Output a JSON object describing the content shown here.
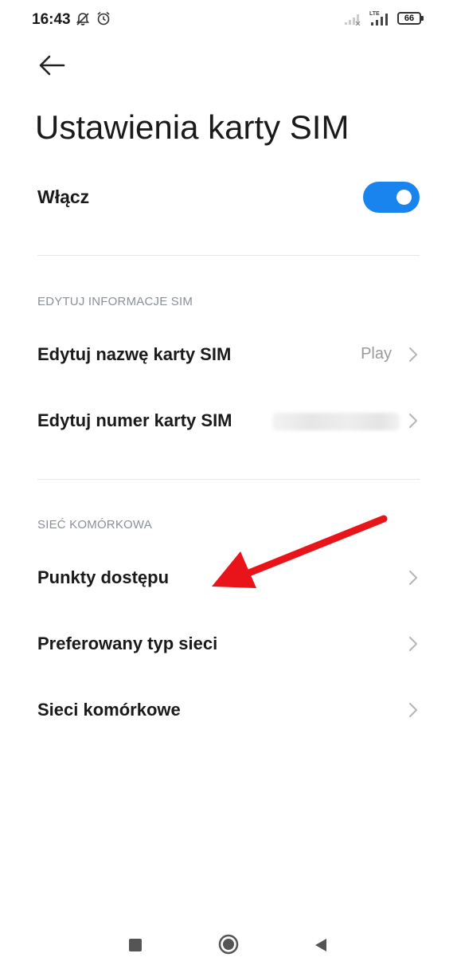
{
  "status_bar": {
    "time": "16:43",
    "icons": [
      "notifications-off-icon",
      "alarm-icon",
      "signal-weak-icon",
      "lte-signal-icon",
      "battery-icon"
    ],
    "lte_label": "LTE",
    "battery_level": "66"
  },
  "header": {
    "back_icon": "arrow-left-icon",
    "title": "Ustawienia karty SIM"
  },
  "toggle": {
    "label": "Włącz",
    "state": "on",
    "accent_color": "#1a84ee"
  },
  "sections": [
    {
      "header": "EDYTUJ INFORMACJE SIM",
      "items": [
        {
          "label": "Edytuj nazwę karty SIM",
          "value": "Play"
        },
        {
          "label": "Edytuj numer karty SIM",
          "value": ""
        }
      ]
    },
    {
      "header": "SIEĆ KOMÓRKOWA",
      "items": [
        {
          "label": "Punkty dostępu"
        },
        {
          "label": "Preferowany typ sieci"
        },
        {
          "label": "Sieci komórkowe"
        }
      ]
    }
  ],
  "annotation": {
    "arrow_color": "#e8141a",
    "target": "Punkty dostępu"
  },
  "nav_bar": {
    "buttons": [
      "recents-button",
      "home-button",
      "back-button"
    ]
  }
}
